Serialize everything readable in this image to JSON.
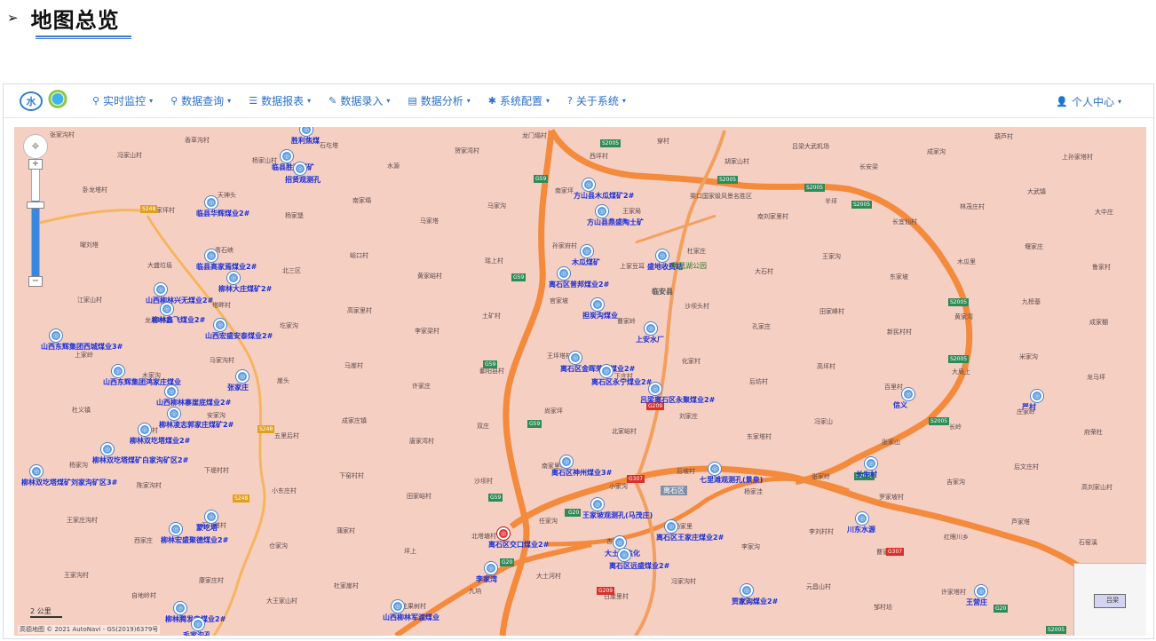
{
  "heading": {
    "arrow": "➢",
    "title": "地图总览"
  },
  "nav": {
    "items": [
      {
        "icon": "location-pin-icon",
        "glyph": "⚲",
        "label": "实时监控"
      },
      {
        "icon": "search-icon",
        "glyph": "⚲",
        "label": "数据查询"
      },
      {
        "icon": "list-icon",
        "glyph": "☰",
        "label": "数据报表"
      },
      {
        "icon": "edit-icon",
        "glyph": "✎",
        "label": "数据录入"
      },
      {
        "icon": "analysis-icon",
        "glyph": "▤",
        "label": "数据分析"
      },
      {
        "icon": "gear-icon",
        "glyph": "✱",
        "label": "系统配置"
      },
      {
        "icon": "question-icon",
        "glyph": "?",
        "label": "关于系统"
      }
    ],
    "user": {
      "icon": "user-icon",
      "glyph": "👤",
      "label": "个人中心"
    },
    "caret": "▾"
  },
  "map": {
    "scale": "2 公里",
    "copyright": "高德地图 © 2021 AutoNavi - GS(2019)6379号",
    "minimap_label": "吕梁",
    "colors": {
      "background": "#f6cfc3",
      "highway": "#f38a3c",
      "marker": "#5b9be0",
      "label": "#1a2fd8"
    },
    "markers": [
      {
        "label": "胜利焦煤"
      },
      {
        "label": "临县胜利煤矿"
      },
      {
        "label": "招贤观测孔"
      },
      {
        "label": "临县华辉煤业2#"
      },
      {
        "label": "临县高家焉煤业2#"
      },
      {
        "label": "柳林大庄煤矿2#"
      },
      {
        "label": "山西柳林兴无煤业2#"
      },
      {
        "label": "柳林鑫飞煤业2#"
      },
      {
        "label": "山西宏盛安泰煤业2#"
      },
      {
        "label": "山西东辉集团西城煤业3#"
      },
      {
        "label": "山西东辉集团鸿家庄煤业"
      },
      {
        "label": "山西柳林寨崖底煤业2#"
      },
      {
        "label": "柳林凌志郭家庄煤矿2#"
      },
      {
        "label": "柳林双圪塔煤业2#"
      },
      {
        "label": "柳林双圪塔煤矿白家沟矿区2#"
      },
      {
        "label": "柳林双圪塔煤矿刘家沟矿区3#"
      },
      {
        "label": "蒙圪塔"
      },
      {
        "label": "柳林宏盛聚德煤业2#"
      },
      {
        "label": "柳林腾发电煤业2#"
      },
      {
        "label": "毛家沟孔"
      },
      {
        "label": "山西柳林军渡煤业"
      },
      {
        "label": "张家庄"
      },
      {
        "label": "方山县木瓜煤矿2#"
      },
      {
        "label": "方山县鼎盛陶土矿"
      },
      {
        "label": "木瓜煤矿"
      },
      {
        "label": "离石区普邦煤业2#"
      },
      {
        "label": "担炭沟煤业"
      },
      {
        "label": "盛地收费站"
      },
      {
        "label": "上安水厂"
      },
      {
        "label": "离石区金晖荣泰煤业2#"
      },
      {
        "label": "离石区永宁煤业2#"
      },
      {
        "label": "吕梁离石区永聚煤业2#"
      },
      {
        "label": "离石区神州煤业3#"
      },
      {
        "label": "王家坡观测孔(马茂庄)"
      },
      {
        "label": "离石区王家庄煤业2#"
      },
      {
        "label": "大土河焦化"
      },
      {
        "label": "离石区远盛煤业2#"
      },
      {
        "label": "离石区交口煤业2#"
      },
      {
        "label": "李家湾"
      },
      {
        "label": "七里滩观测孔(景泉)"
      },
      {
        "label": "长生村"
      },
      {
        "label": "信义"
      },
      {
        "label": "严村"
      },
      {
        "label": "川东水源"
      },
      {
        "label": "贾家沟煤业2#"
      },
      {
        "label": "王营庄"
      }
    ],
    "roads": [
      {
        "code": "S2005",
        "kind": "g"
      },
      {
        "code": "G59",
        "kind": "g"
      },
      {
        "code": "S248",
        "kind": "y"
      },
      {
        "code": "G20",
        "kind": "g"
      },
      {
        "code": "G307",
        "kind": "r"
      },
      {
        "code": "G209",
        "kind": "r"
      }
    ],
    "places": [
      "张家沟村",
      "冯家山村",
      "香草沟村",
      "杨家山村",
      "石圪塔",
      "水源",
      "贺家湾村",
      "龙门塌村",
      "西坪村",
      "穿村",
      "胡家山村",
      "吕梁大武机场",
      "长安梁",
      "成家沟",
      "葫芦村",
      "上孙家塔村",
      "卧龙塔村",
      "杨家坪村",
      "天神头",
      "杨家堡",
      "南家塌",
      "马家塔",
      "马家沟",
      "南家坪",
      "王家局",
      "渠口国家级风景名胜区",
      "南刘家里村",
      "半坪",
      "长宜仙村",
      "林茂庄村",
      "大武镇",
      "大中庄",
      "曜刘塔",
      "大盛垃圾",
      "青石峡",
      "北三区",
      "峪口村",
      "黄家峪村",
      "瑶上村",
      "孙家府村",
      "上家豆耳",
      "杜家庄",
      "大石村",
      "王家沟",
      "东家坡",
      "木瓜里",
      "堰家庄",
      "鲁家村",
      "江家山村",
      "龙尾岭村",
      "塔畔村",
      "圪家沟",
      "高家里村",
      "李家梁村",
      "土矿村",
      "官家坡",
      "曹家岭",
      "沙坝头村",
      "孔家庄",
      "田家峰村",
      "新民村村",
      "黄家湾",
      "九榜基",
      "成家棚",
      "上家岭",
      "木家沟",
      "马家沟村",
      "崖头",
      "马崖村",
      "许家庄",
      "鄱阳县村",
      "王坪塔村",
      "下庄村",
      "化家村",
      "后坊村",
      "高坪村",
      "百里村",
      "大局上",
      "米家沟",
      "龙马坪",
      "杜义镇",
      "王村村",
      "安家沟",
      "五里后村",
      "成家庄镇",
      "唐家湾村",
      "双庄",
      "尚家坪",
      "北家峪村",
      "刘家庄",
      "东家塔村",
      "冯家山",
      "张家山",
      "长岭",
      "庄家岭",
      "府荣杜",
      "杨家沟",
      "陈家沟村",
      "下堤村村",
      "小东庄村",
      "下窑村村",
      "田家峪村",
      "沙坝村",
      "南家里村",
      "小家沟",
      "后坡村",
      "杨家洼",
      "张家岭",
      "罗家坡村",
      "吉家沟",
      "后文庄村",
      "高刘家山村",
      "王家庄沟村",
      "西家庄",
      "石门塔村",
      "仓家沟",
      "蒲家村",
      "坪上",
      "北塔塘村",
      "任家沟",
      "杏家沟",
      "杨家里",
      "李家沟",
      "李刘村村",
      "曹家坡",
      "红眼川乡",
      "芦家塔",
      "石窑溪",
      "王家沟村",
      "自地岭村",
      "康家庄村",
      "大王家山村",
      "杜家崖村",
      "花果树村",
      "九垧",
      "大土河村",
      "白崖里村",
      "冯家沟村",
      "庞家沟",
      "元昌山村",
      "邹村坊",
      "许家塔村"
    ],
    "city": "离石区",
    "park": "凤凰湖公园",
    "county": "临安县"
  }
}
